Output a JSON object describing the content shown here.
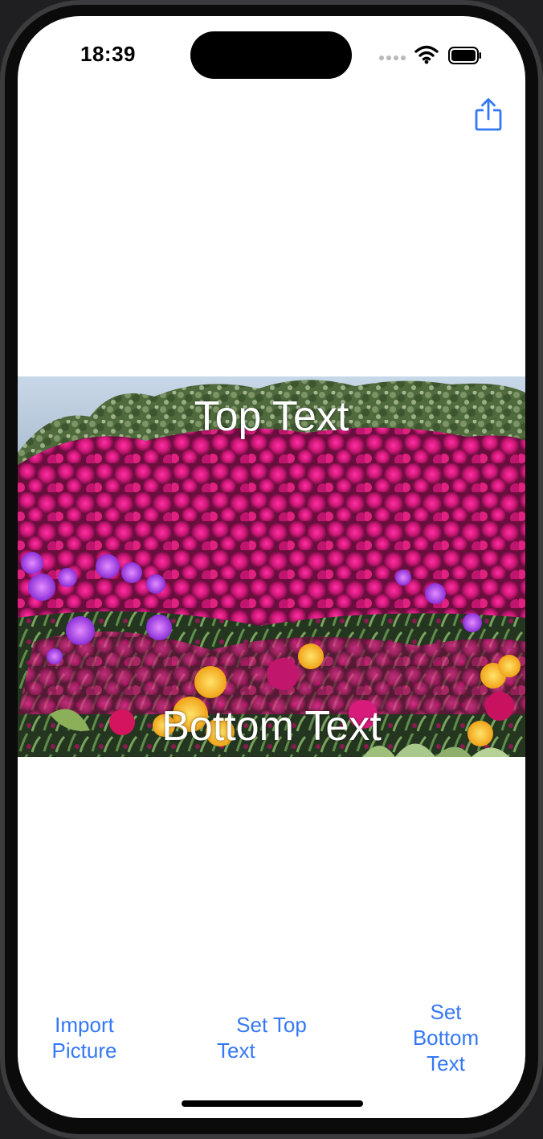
{
  "status_bar": {
    "time": "18:39"
  },
  "icons": {
    "share": "share-icon",
    "wifi": "wifi-icon",
    "battery": "battery-icon",
    "signal": "cellular-signal-icon"
  },
  "meme": {
    "top_text": "Top Text",
    "bottom_text": "Bottom Text"
  },
  "toolbar": {
    "import_line1": "Import",
    "import_line2": "Picture",
    "set_top_line1": "Set Top",
    "set_top_line2": "Text",
    "set_bottom_line1": "Set",
    "set_bottom_line2": "Bottom",
    "set_bottom_line3": "Text"
  },
  "colors": {
    "accent": "#3478f6",
    "background": "#ffffff"
  }
}
